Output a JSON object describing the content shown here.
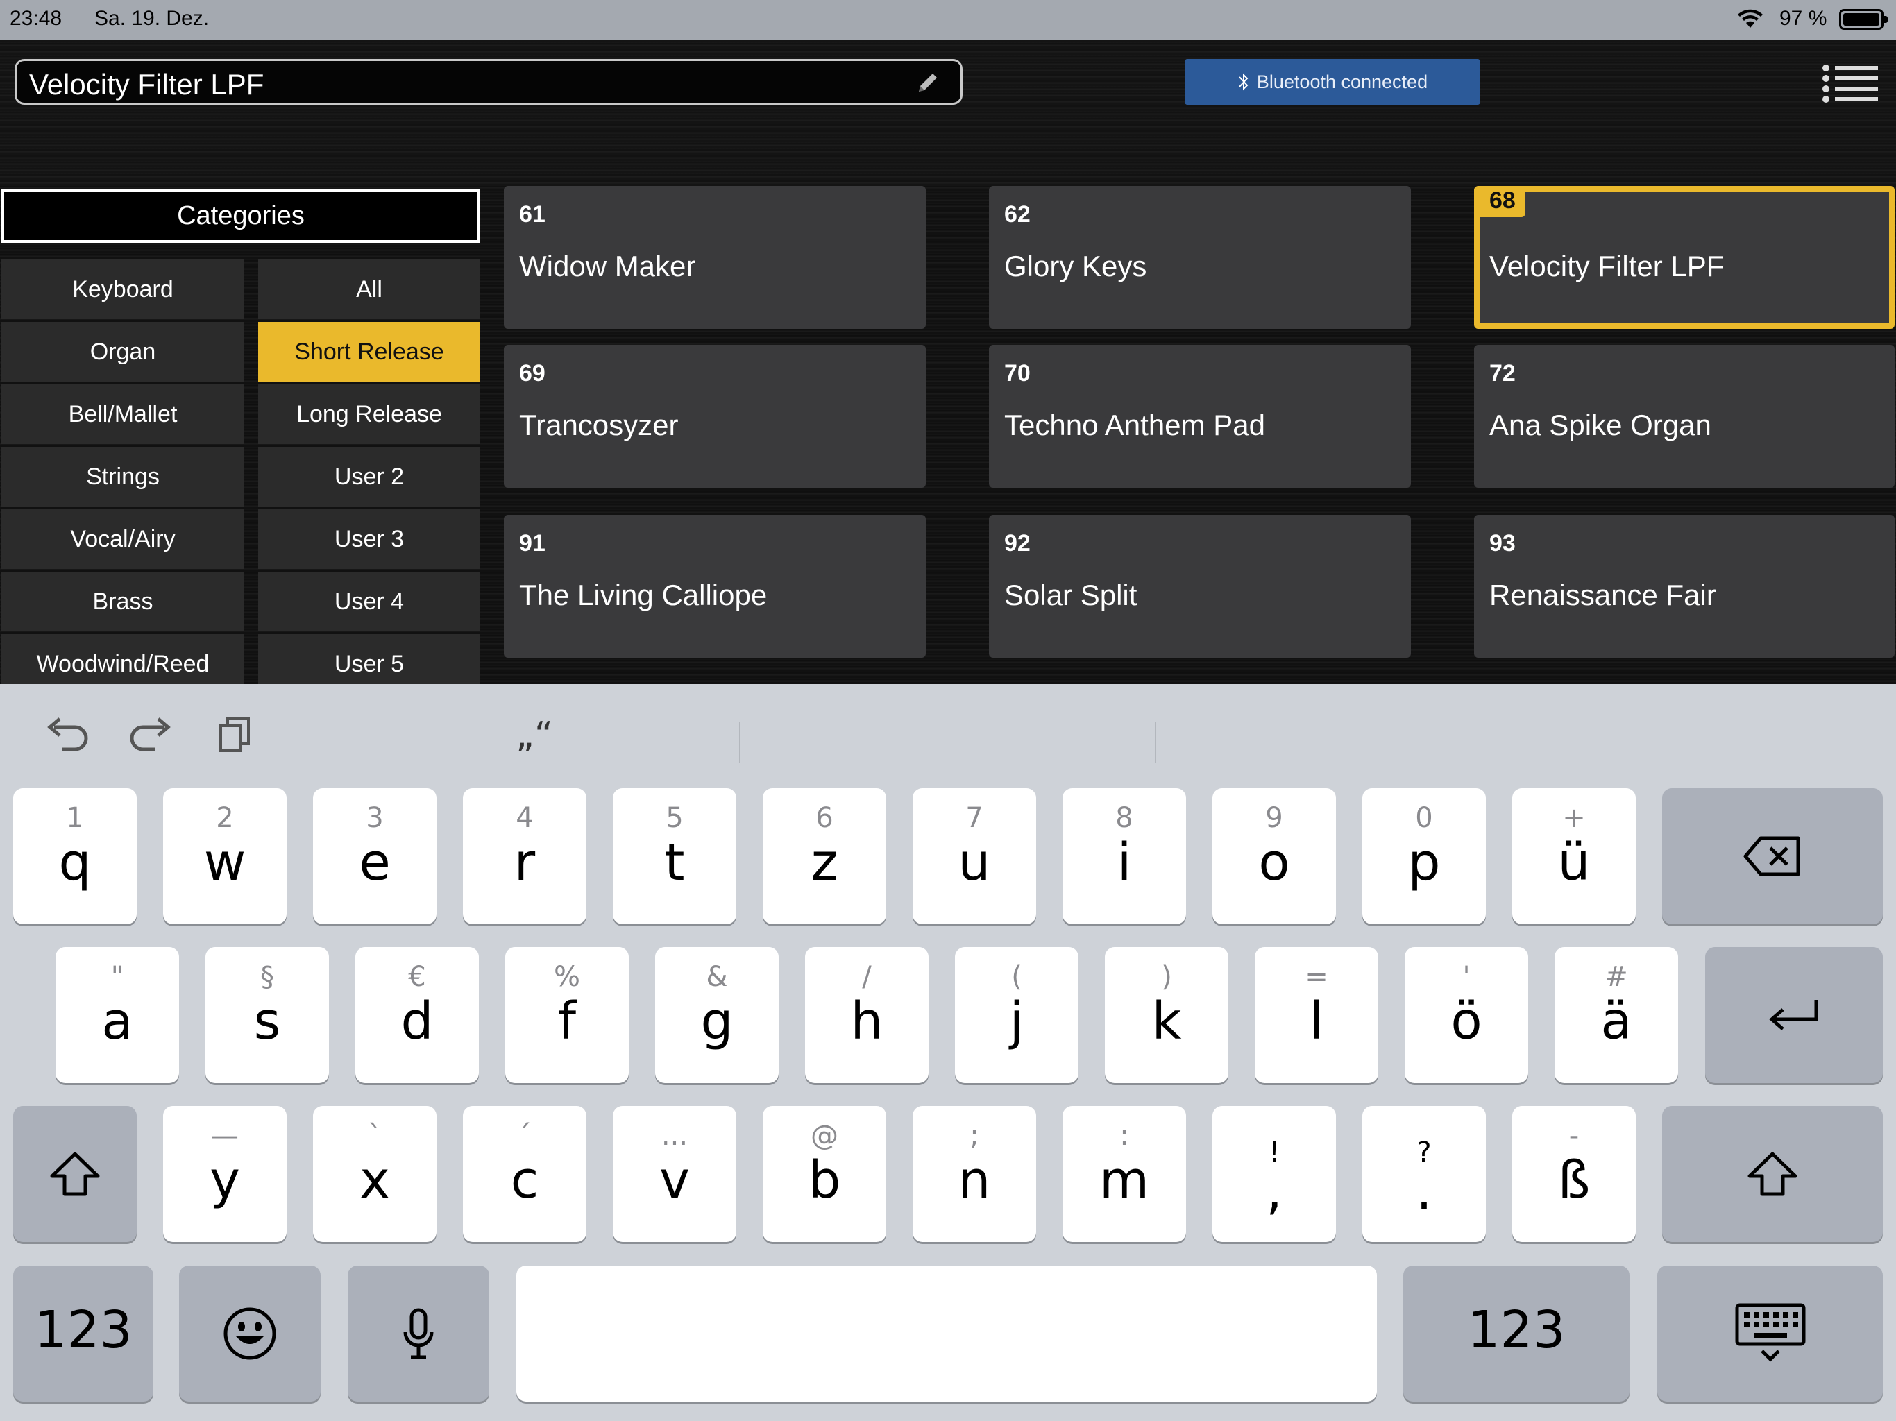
{
  "status": {
    "time": "23:48",
    "date": "Sa. 19. Dez.",
    "battery": "97 %"
  },
  "header": {
    "preset_name": "Velocity Filter LPF",
    "bluetooth_status": "Bluetooth connected"
  },
  "categories": {
    "title": "Categories",
    "left": [
      "Keyboard",
      "Organ",
      "Bell/Mallet",
      "Strings",
      "Vocal/Airy",
      "Brass",
      "Woodwind/Reed"
    ],
    "right": [
      "All",
      "Short Release",
      "Long Release",
      "User 2",
      "User 3",
      "User 4",
      "User 5"
    ],
    "selected_right": "Short Release"
  },
  "presets": [
    {
      "num": "61",
      "name": "Widow Maker"
    },
    {
      "num": "62",
      "name": "Glory Keys"
    },
    {
      "num": "68",
      "name": "Velocity Filter LPF"
    },
    {
      "num": "69",
      "name": "Trancosyzer"
    },
    {
      "num": "70",
      "name": "Techno Anthem Pad"
    },
    {
      "num": "72",
      "name": "Ana Spike Organ"
    },
    {
      "num": "91",
      "name": "The Living Calliope"
    },
    {
      "num": "92",
      "name": "Solar Split"
    },
    {
      "num": "93",
      "name": "Renaissance Fair"
    }
  ],
  "selected_preset": "68",
  "keyboard": {
    "suggestion": "„“",
    "row1": [
      {
        "s": "1",
        "p": "q"
      },
      {
        "s": "2",
        "p": "w"
      },
      {
        "s": "3",
        "p": "e"
      },
      {
        "s": "4",
        "p": "r"
      },
      {
        "s": "5",
        "p": "t"
      },
      {
        "s": "6",
        "p": "z"
      },
      {
        "s": "7",
        "p": "u"
      },
      {
        "s": "8",
        "p": "i"
      },
      {
        "s": "9",
        "p": "o"
      },
      {
        "s": "0",
        "p": "p"
      },
      {
        "s": "+",
        "p": "ü"
      }
    ],
    "row2": [
      {
        "s": "\"",
        "p": "a"
      },
      {
        "s": "§",
        "p": "s"
      },
      {
        "s": "€",
        "p": "d"
      },
      {
        "s": "%",
        "p": "f"
      },
      {
        "s": "&",
        "p": "g"
      },
      {
        "s": "/",
        "p": "h"
      },
      {
        "s": "(",
        "p": "j"
      },
      {
        "s": ")",
        "p": "k"
      },
      {
        "s": "=",
        "p": "l"
      },
      {
        "s": "'",
        "p": "ö"
      },
      {
        "s": "#",
        "p": "ä"
      }
    ],
    "row3": [
      {
        "s": "—",
        "p": "y"
      },
      {
        "s": "`",
        "p": "x"
      },
      {
        "s": "´",
        "p": "c"
      },
      {
        "s": "...",
        "p": "v"
      },
      {
        "s": "@",
        "p": "b"
      },
      {
        "s": ";",
        "p": "n"
      },
      {
        "s": ":",
        "p": "m"
      },
      {
        "s": "!",
        "p": ","
      },
      {
        "s": "?",
        "p": "."
      },
      {
        "s": "-",
        "p": "ß"
      }
    ],
    "numbers_label": "123"
  }
}
